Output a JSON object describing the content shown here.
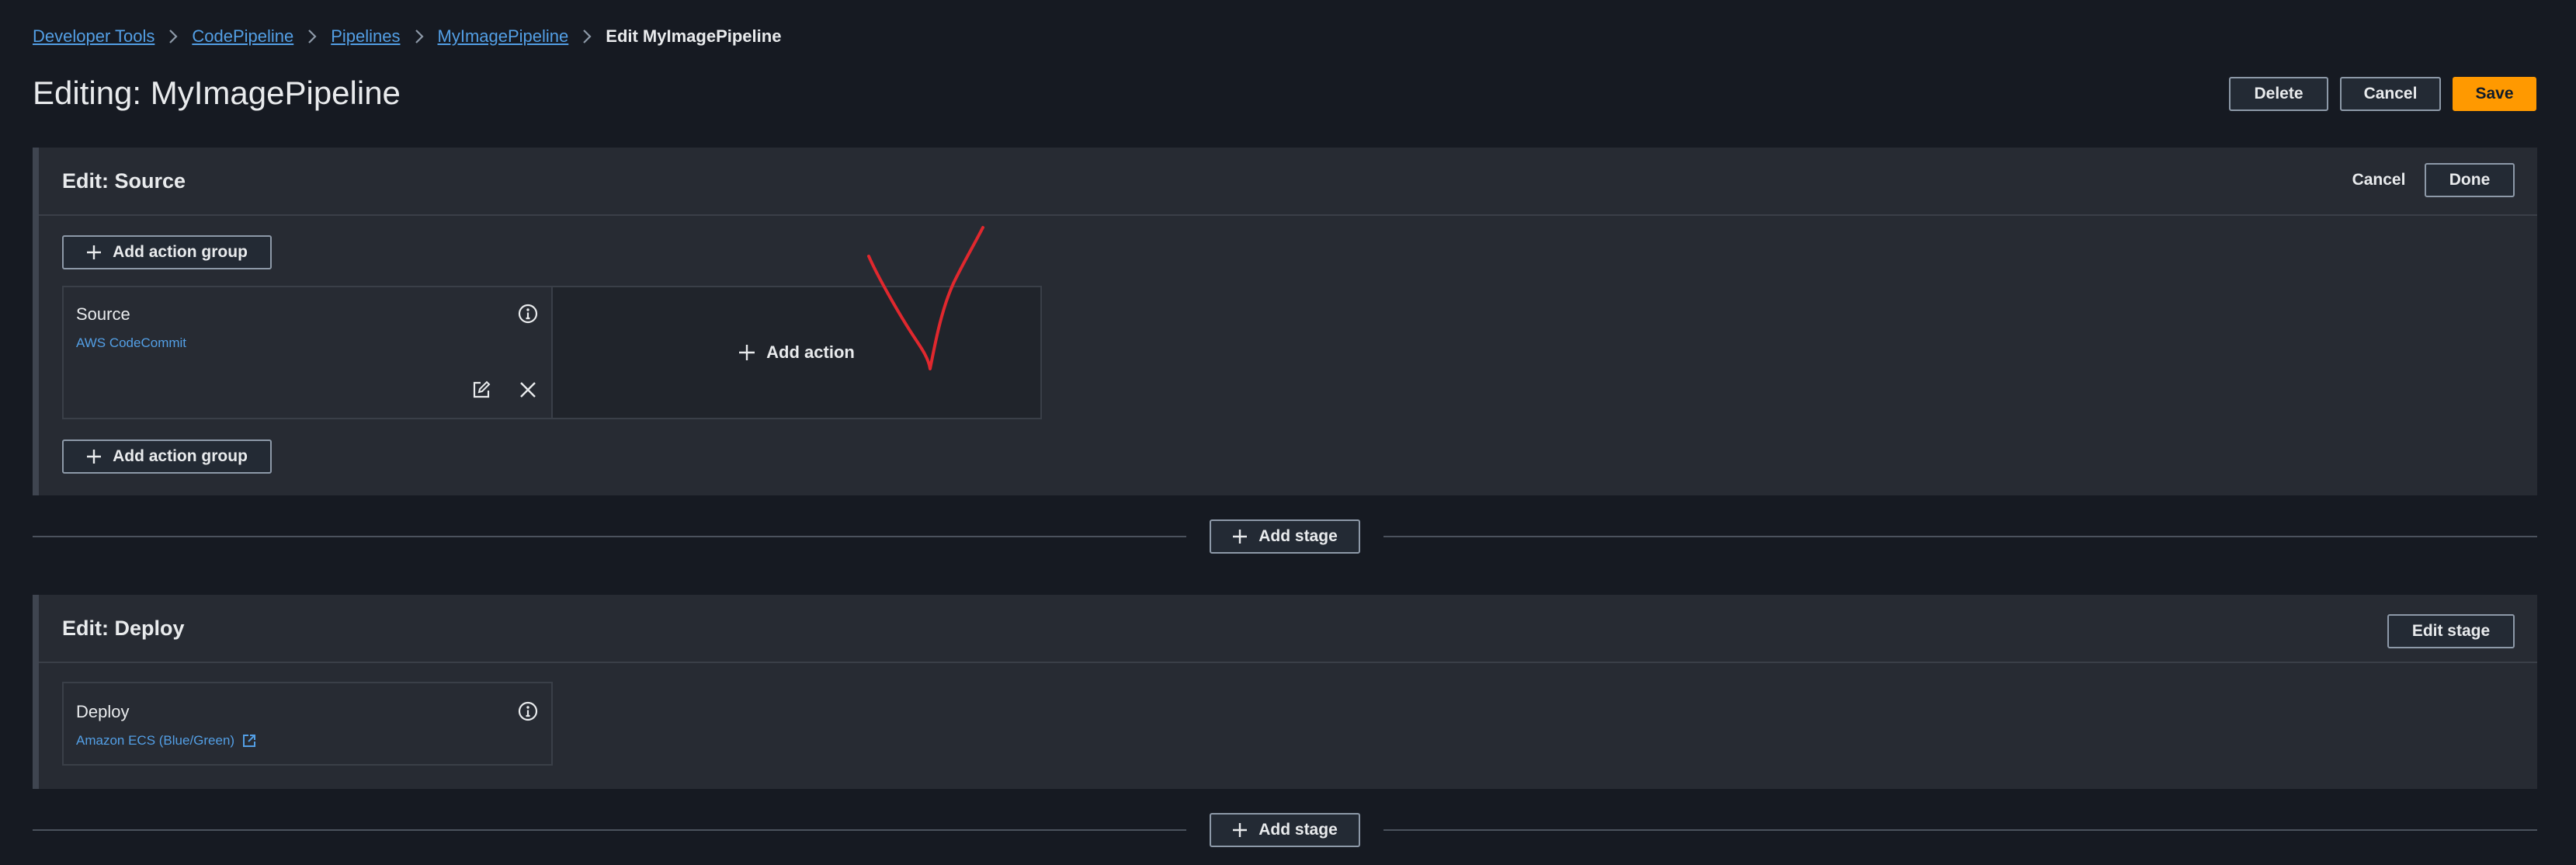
{
  "breadcrumb": {
    "items": [
      "Developer Tools",
      "CodePipeline",
      "Pipelines",
      "MyImagePipeline"
    ],
    "current": "Edit MyImagePipeline"
  },
  "page": {
    "title": "Editing: MyImagePipeline",
    "delete_label": "Delete",
    "cancel_label": "Cancel",
    "save_label": "Save"
  },
  "source_stage": {
    "title": "Edit: Source",
    "cancel_label": "Cancel",
    "done_label": "Done",
    "add_action_group_label": "Add action group",
    "action": {
      "name": "Source",
      "provider": "AWS CodeCommit"
    },
    "add_action_label": "Add action"
  },
  "add_stage_label": "Add stage",
  "deploy_stage": {
    "title": "Edit: Deploy",
    "edit_stage_label": "Edit stage",
    "action": {
      "name": "Deploy",
      "provider": "Amazon ECS (Blue/Green)"
    }
  },
  "colors": {
    "accent": "#539fe5",
    "primary_button": "#ff9900",
    "annotation": "#e0282e"
  },
  "icons": [
    "chevron-right-icon",
    "plus-icon",
    "info-icon",
    "edit-icon",
    "close-icon",
    "external-link-icon"
  ]
}
